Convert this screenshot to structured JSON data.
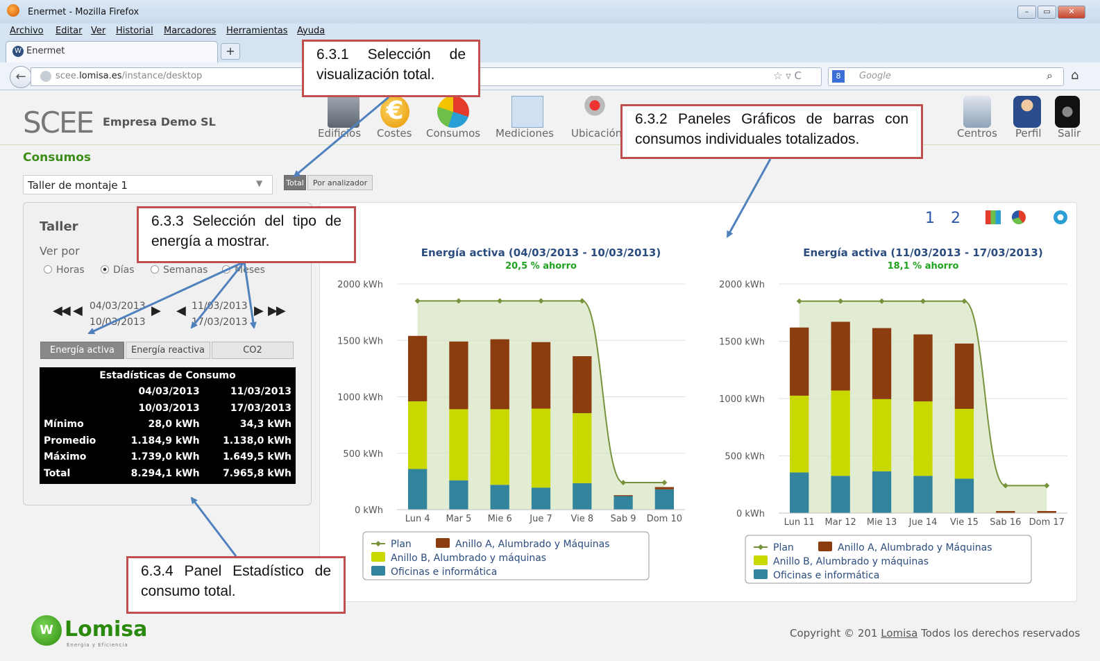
{
  "window": {
    "title": "Enermet - Mozilla Firefox"
  },
  "menu": [
    "Archivo",
    "Editar",
    "Ver",
    "Historial",
    "Marcadores",
    "Herramientas",
    "Ayuda"
  ],
  "tab": {
    "label": "Enermet",
    "new_tab": "+"
  },
  "url": {
    "prefix": "scee.",
    "domain": "lomisa.es",
    "path": "/instance/desktop"
  },
  "search": {
    "placeholder": "Google"
  },
  "app": {
    "logo": "SCEE",
    "company": "Empresa Demo SL",
    "nav": [
      "Edificios",
      "Costes",
      "Consumos",
      "Mediciones",
      "Ubicación",
      "Centros",
      "Perfil",
      "Salir"
    ]
  },
  "page": {
    "section_title": "Consumos",
    "centro": "Taller de montaje 1",
    "view_buttons": {
      "total": "Total",
      "analizador": "Por analizador"
    }
  },
  "left": {
    "title": "Taller",
    "ver_por": "Ver por",
    "radios": [
      "Horas",
      "Días",
      "Semanas",
      "Meses"
    ],
    "selected_radio": "Días",
    "range1": [
      "04/03/2013",
      "10/03/2013"
    ],
    "range2": [
      "11/03/2013",
      "17/03/2013"
    ],
    "energy_buttons": [
      "Energía activa",
      "Energía reactiva",
      "CO2"
    ],
    "selected_energy": "Energía activa"
  },
  "stats": {
    "title": "Estadísticas de Consumo",
    "head1": [
      "04/03/2013",
      "11/03/2013"
    ],
    "head2": [
      "10/03/2013",
      "17/03/2013"
    ],
    "rows": [
      {
        "label": "Mínimo",
        "a": "28,0 kWh",
        "b": "34,3 kWh"
      },
      {
        "label": "Promedio",
        "a": "1.184,9 kWh",
        "b": "1.138,0 kWh"
      },
      {
        "label": "Máximo",
        "a": "1.739,0 kWh",
        "b": "1.649,5 kWh"
      },
      {
        "label": "Total",
        "a": "8.294,1 kWh",
        "b": "7.965,8 kWh"
      }
    ]
  },
  "chart_panel": {
    "pages": [
      "1",
      "2"
    ]
  },
  "chart_data": [
    {
      "type": "bar",
      "stacked": true,
      "title": "Energía activa (04/03/2013 - 10/03/2013)",
      "subtitle": "20,5 % ahorro",
      "categories": [
        "Lun 4",
        "Mar 5",
        "Mie 6",
        "Jue 7",
        "Vie 8",
        "Sab 9",
        "Dom 10"
      ],
      "y_ticks": [
        "0 kWh",
        "500 kWh",
        "1000 kWh",
        "1500 kWh",
        "2000 kWh"
      ],
      "ylim": [
        0,
        2000
      ],
      "series": [
        {
          "name": "Oficinas e informática",
          "color": "#31849b",
          "values": [
            360,
            260,
            220,
            195,
            235,
            120,
            180
          ]
        },
        {
          "name": "Anillo B, Alumbrado y máquinas",
          "color": "#c8d800",
          "values": [
            600,
            630,
            670,
            700,
            620,
            0,
            0
          ]
        },
        {
          "name": "Anillo A, Alumbrado y Máquinas",
          "color": "#8b3d10",
          "values": [
            580,
            600,
            620,
            590,
            505,
            8,
            20
          ]
        }
      ],
      "plan": {
        "name": "Plan",
        "color": "#76933c",
        "values": [
          1850,
          1850,
          1850,
          1850,
          1850,
          240,
          240
        ]
      }
    },
    {
      "type": "bar",
      "stacked": true,
      "title": "Energía activa (11/03/2013 - 17/03/2013)",
      "subtitle": "18,1 % ahorro",
      "categories": [
        "Lun 11",
        "Mar 12",
        "Mie 13",
        "Jue 14",
        "Vie 15",
        "Sab 16",
        "Dom 17"
      ],
      "y_ticks": [
        "0 kWh",
        "500 kWh",
        "1000 kWh",
        "1500 kWh",
        "2000 kWh"
      ],
      "ylim": [
        0,
        2000
      ],
      "series": [
        {
          "name": "Oficinas e informática",
          "color": "#31849b",
          "values": [
            355,
            325,
            365,
            325,
            300,
            0,
            0
          ]
        },
        {
          "name": "Anillo B, Alumbrado y máquinas",
          "color": "#c8d800",
          "values": [
            670,
            745,
            630,
            650,
            610,
            0,
            0
          ]
        },
        {
          "name": "Anillo A, Alumbrado y Máquinas",
          "color": "#8b3d10",
          "values": [
            595,
            600,
            620,
            585,
            570,
            18,
            18
          ]
        }
      ],
      "plan": {
        "name": "Plan",
        "color": "#76933c",
        "values": [
          1850,
          1850,
          1850,
          1850,
          1850,
          240,
          240
        ]
      }
    }
  ],
  "footer": {
    "logo": "Lomisa",
    "tagline": "Energía y Eficiencia",
    "copyright_pre": "Copyright © 201",
    "copyright_link": "Lomisa",
    "copyright_post": " Todos los derechos reservados"
  },
  "annotations": {
    "a1": "6.3.1 Selección de visualización total.",
    "a2": "6.3.2 Paneles Gráficos de barras con consumos individuales totalizados.",
    "a3": "6.3.3 Selección del tipo de energía a mostrar.",
    "a4": "6.3.4 Panel Estadístico de consumo total.",
    "border_color": "#c0504d",
    "arrow_color": "#4f81bd"
  }
}
